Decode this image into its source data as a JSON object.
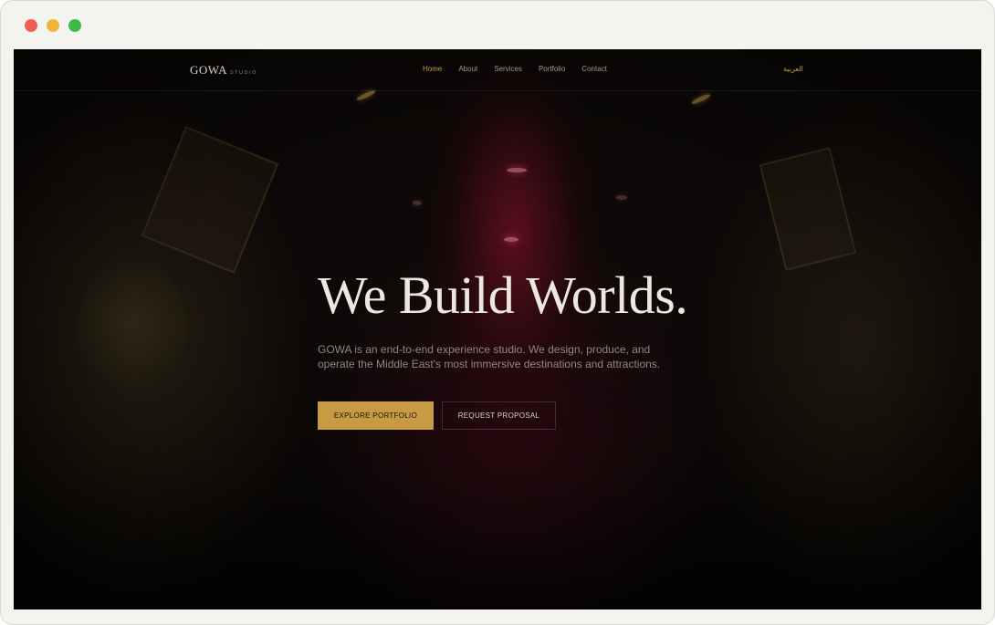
{
  "window": {
    "traffic_lights": [
      "close",
      "minimize",
      "zoom"
    ]
  },
  "nav": {
    "logo": {
      "main": "GOWA",
      "sub": "STUDIO"
    },
    "links": [
      {
        "label": "Home",
        "active": true
      },
      {
        "label": "About",
        "active": false
      },
      {
        "label": "Services",
        "active": false
      },
      {
        "label": "Portfolio",
        "active": false
      },
      {
        "label": "Contact",
        "active": false
      }
    ],
    "language": "العربية"
  },
  "hero": {
    "title": "We Build Worlds.",
    "subtitle": "GOWA is an end-to-end experience studio. We design, produce, and operate the Middle East's most immersive destinations and attractions.",
    "primary_button": "EXPLORE PORTFOLIO",
    "secondary_button": "REQUEST PROPOSAL"
  },
  "colors": {
    "accent": "#c99a44",
    "background": "#050404",
    "title_text": "#ece7df",
    "body_text": "#8e8880"
  }
}
